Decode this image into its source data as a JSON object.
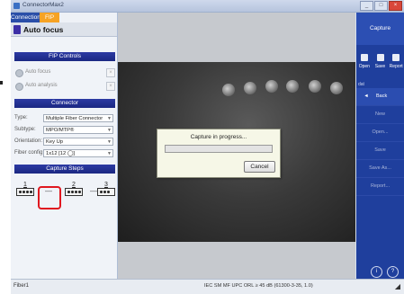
{
  "window": {
    "title": "ConnectorMax2"
  },
  "tabs": [
    {
      "label": "Connection"
    },
    {
      "label": "FIP"
    }
  ],
  "mode": {
    "label": "Auto focus"
  },
  "fip_controls": {
    "header": "FIP Controls",
    "options": [
      {
        "label": "Auto focus"
      },
      {
        "label": "Auto analysis"
      }
    ]
  },
  "connector": {
    "header": "Connector",
    "fields": [
      {
        "label": "Type:",
        "value": "Multiple Fiber Connector"
      },
      {
        "label": "Subtype:",
        "value": "MPO/MTP®"
      },
      {
        "label": "Orientation:",
        "value": "Key Up"
      },
      {
        "label": "Fiber config:",
        "value": "1x12 [12 ◯]"
      }
    ]
  },
  "capture_steps": {
    "header": "Capture Steps",
    "steps": [
      "1",
      "2",
      "3"
    ]
  },
  "dialog": {
    "message": "Capture in progress...",
    "cancel": "Cancel",
    "progress": 0
  },
  "right_panel": {
    "capture": "Capture",
    "tools": [
      "Open",
      "Save",
      "Report"
    ],
    "file_label": "dat",
    "menu": [
      "Back",
      "New",
      "Open...",
      "Save",
      "Save As...",
      "Report..."
    ],
    "back_arrow": "◄"
  },
  "status": {
    "left": "Fiber1",
    "middle": "IEC SM MF UPC ORL ≥ 45 dB (61300-3-35, 1.0)"
  },
  "colors": {
    "accent": "#1f3f9d",
    "tab_fip": "#f6a324",
    "highlight": "#e0171f"
  }
}
